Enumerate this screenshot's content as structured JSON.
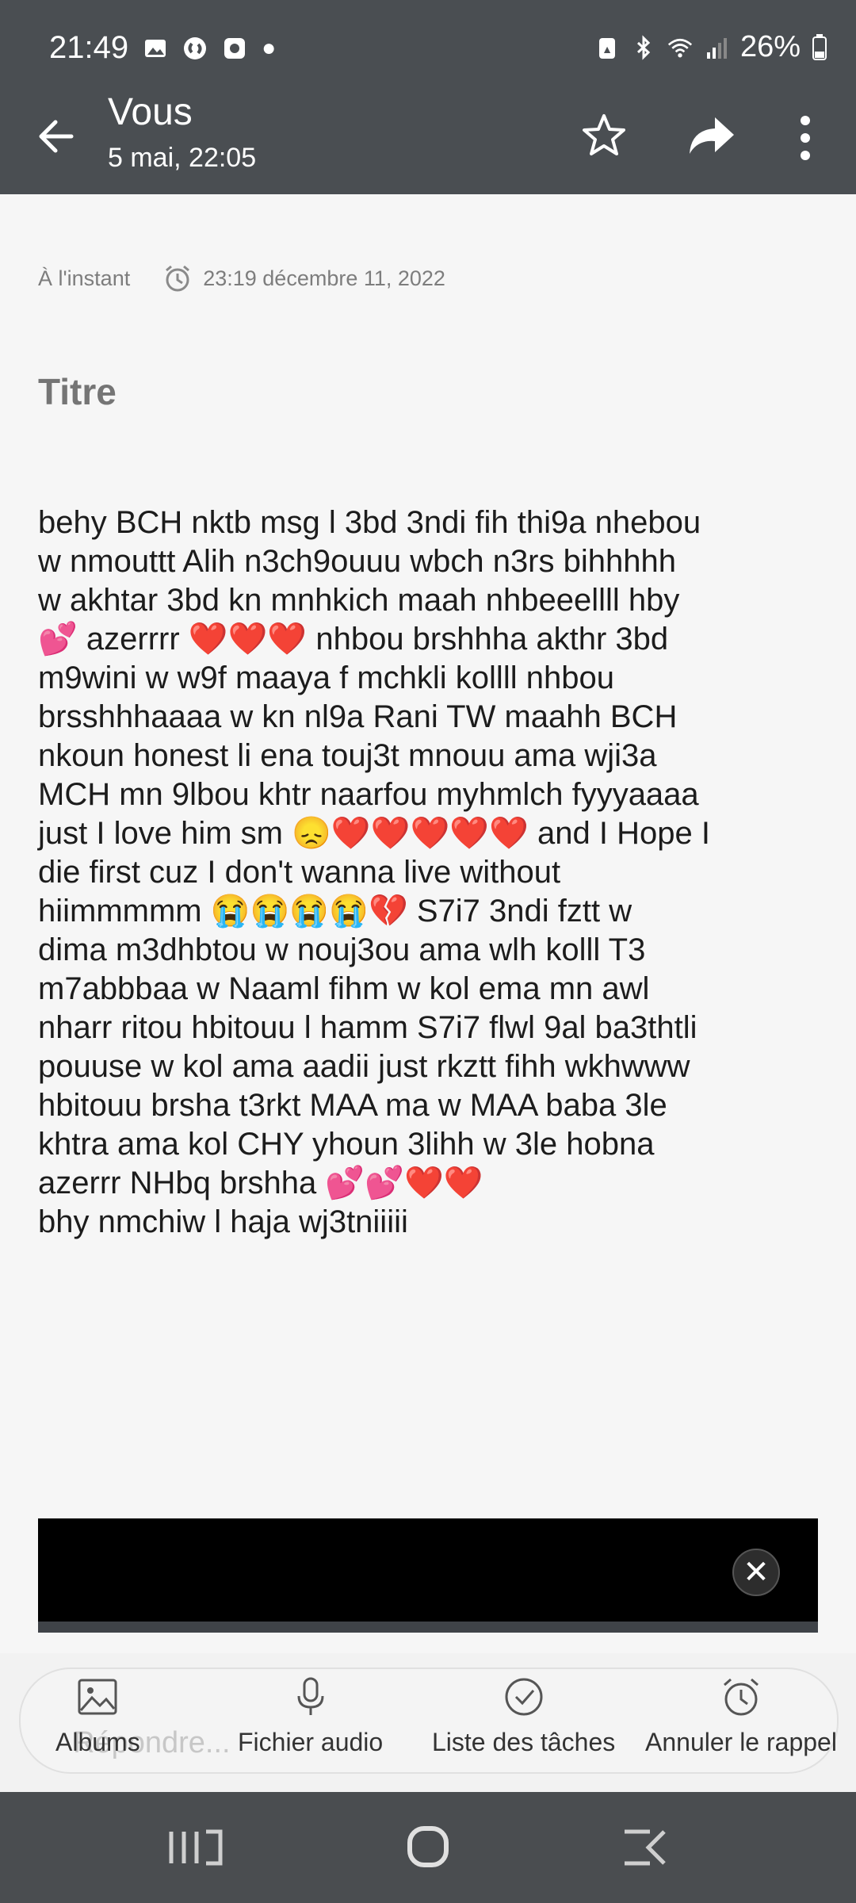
{
  "status": {
    "time": "21:49",
    "battery": "26%"
  },
  "header": {
    "title": "Vous",
    "subtitle": "5 mai, 22:05"
  },
  "note": {
    "modified": "À l'instant",
    "reminder": "23:19 décembre 11, 2022",
    "title": "Titre",
    "body": "behy BCH nktb msg l 3bd 3ndi fih thi9a nhebou\nw nmouttt Alih n3ch9ouuu wbch n3rs bihhhhh\nw akhtar 3bd kn mnhkich maah nhbeeellll hby\n💕 azerrrr ❤️❤️❤️ nhbou brshhha akthr 3bd\nm9wini w w9f maaya f mchkli kollll nhbou\nbrsshhhaaaa w kn nl9a Rani TW maahh BCH\nnkoun honest li ena touj3t mnouu ama wji3a\nMCH mn 9lbou khtr naarfou myhmlch fyyyaaaa\njust I love him sm 😞❤️❤️❤️❤️❤️ and I Hope I\ndie first cuz I don't wanna live without\nhiimmmmm 😭😭😭😭💔 S7i7 3ndi fztt w\ndima m3dhbtou w nouj3ou ama wlh kolll T3\nm7abbbaa w Naaml fihm w kol ema mn awl\nnharr ritou hbitouu l hamm S7i7 flwl 9al ba3thtli\npouuse w kol ama aadii just rkztt fihh wkhwww\nhbitouu brsha t3rkt MAA ma w MAA baba 3le\nkhtra ama kol CHY yhoun 3lihh w 3le hobna\nazerrr NHbq brshha 💕💕❤️❤️\nbhy nmchiw l haja wj3tniiiii"
  },
  "ad": {
    "close": "✕"
  },
  "reply": {
    "placeholder": "Répondre..."
  },
  "toolbar": {
    "albums": "Albums",
    "audio": "Fichier audio",
    "tasks": "Liste des tâches",
    "reminder": "Annuler le rappel"
  }
}
